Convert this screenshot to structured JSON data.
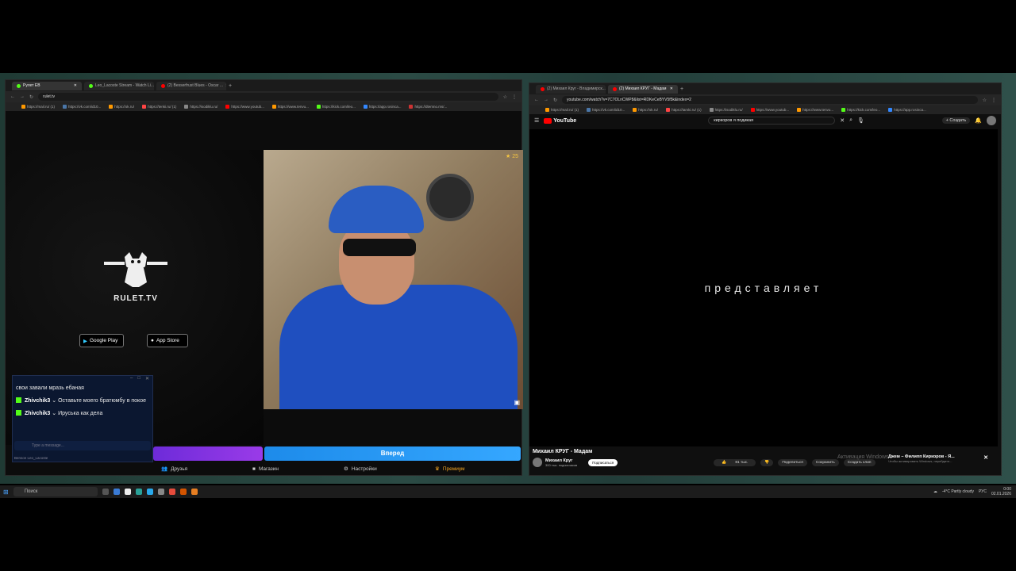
{
  "left_browser": {
    "tabs": [
      {
        "label": "Рулет ЕВ",
        "color": "#53fc18"
      },
      {
        "label": "Leo_Lacoste Stream - Watch Li...",
        "color": "#53fc18"
      },
      {
        "label": "(2) Besserfrust Blues - Oscar ...",
        "color": "#ff0000"
      }
    ],
    "url": "rulet.tv",
    "bookmarks": [
      "https://mail.ru/ (1)",
      "https://vk.com/id10...",
      "https://ok.ru/",
      "https://tenki.ru/ (1)",
      "https://isodiklu.ru/",
      "https://www.youtub...",
      "https://www.tenvu...",
      "https://kick.com/leo...",
      "https://app.rosinca...",
      "https://dtemno.ms/..."
    ],
    "rulet_logo_text": "RULET.TV",
    "google_play_label": "Google Play",
    "app_store_label": "App Store",
    "stars_count": "25",
    "chat": {
      "messages": [
        {
          "user": "",
          "text": "свои завали мразь ебаная"
        },
        {
          "user": "Zhivchik3",
          "text": "Оставьте моего братюмбу в покое"
        },
        {
          "user": "Zhivchik3",
          "text": "Ируська как дела"
        }
      ],
      "input_placeholder": "Type a message...",
      "footer_user": "Benson Leo_Lacoste"
    },
    "blue_button_label": "Вперед",
    "bottom_nav": [
      {
        "label": "Друзья",
        "icon": "users-icon"
      },
      {
        "label": "Магазин",
        "icon": "shop-icon"
      },
      {
        "label": "Настройки",
        "icon": "gear-icon"
      },
      {
        "label": "Премиум",
        "icon": "crown-icon"
      }
    ]
  },
  "right_browser": {
    "tabs": [
      {
        "label": "(2) Михаил Круг - Владимирск...",
        "color": "#ff0000"
      },
      {
        "label": "(2) Михаил КРУГ - Мадам",
        "color": "#ff0000"
      }
    ],
    "url": "youtube.com/watch?v=7C7OLnCWP8&list=RDKeCeBYV5f5k&index=2",
    "bookmarks": [
      "https://mail.ru/ (1)",
      "https://vk.com/id10...",
      "https://ok.ru/",
      "https://tamki.ru/ (1)",
      "https://isodiklu.ru/",
      "https://www.youtub...",
      "https://www.tenvu...",
      "https://kick.com/leo...",
      "https://app.rosinca..."
    ],
    "youtube_label": "YouTube",
    "search_value": "киркоров я подикая",
    "create_label": "Создать",
    "video_caption": "представляет",
    "video_title": "Михаил КРУГ - Мадам",
    "channel_name": "Михаил Круг",
    "channel_subs": "300 тыс. подписчиков",
    "subscribe_label": "Подписаться",
    "likes": "81 тыс.",
    "share_label": "Поделиться",
    "save_label": "Сохранить",
    "clip_label": "Создать клип",
    "activation_text": "Активация Windows",
    "miniplayer_title": "Джем – Филипп Киркоров - Я...",
    "miniplayer_sub": "Чтобы активировать Windows, перейдите..."
  },
  "taskbar": {
    "search_placeholder": "Поиск",
    "weather": "-4°C  Partly cloudy",
    "lang": "РУС",
    "time": "0:00",
    "date": "02.01.2026"
  }
}
